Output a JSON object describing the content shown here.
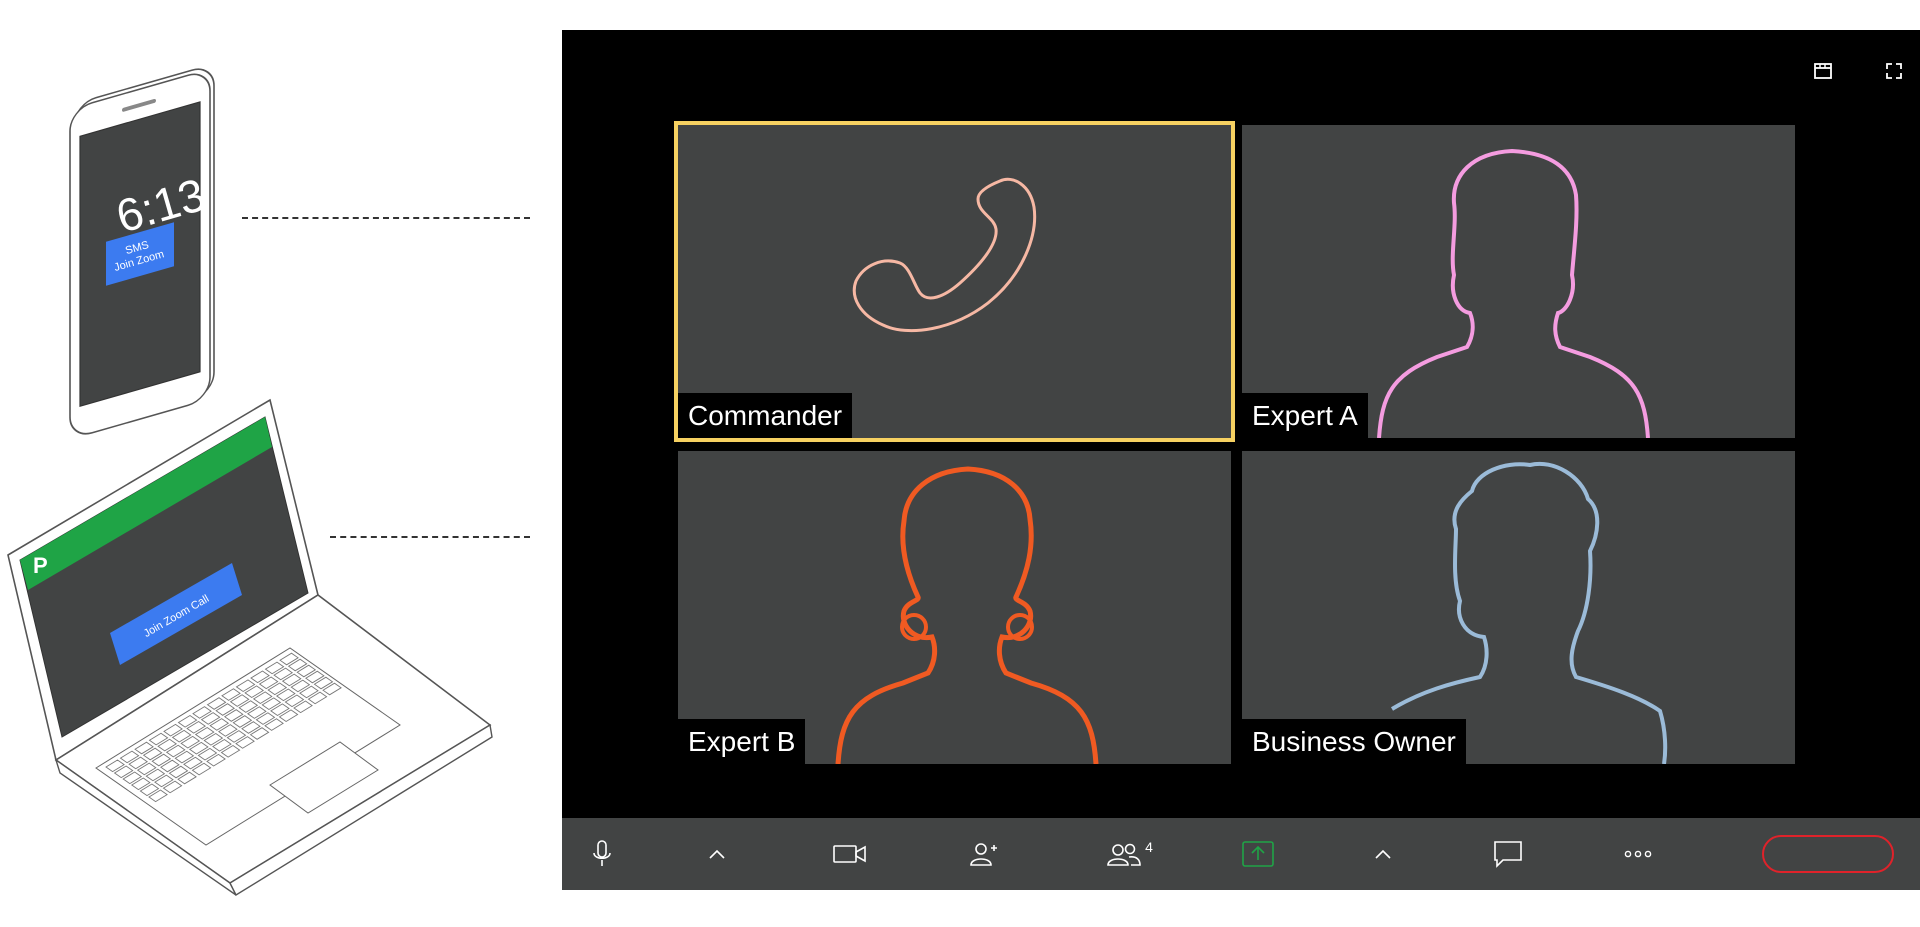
{
  "phone": {
    "time": "6:13",
    "sms_line1": "SMS",
    "sms_line2": "Join Zoom"
  },
  "laptop": {
    "logo": "P",
    "join_button": "Join Zoom Call"
  },
  "call": {
    "tiles": [
      {
        "name": "Commander",
        "active": true,
        "art": "phone-handset",
        "color": "#f6b8a4"
      },
      {
        "name": "Expert A",
        "art": "silhouette-man",
        "color": "#f49ce0"
      },
      {
        "name": "Expert B",
        "art": "silhouette-woman",
        "color": "#f05a22"
      },
      {
        "name": "Business Owner",
        "art": "silhouette-curly",
        "color": "#9bbbd8"
      }
    ],
    "participants_count": "4",
    "colors": {
      "active_border": "#f6d161",
      "share_green": "#1fa446",
      "end_red": "#e0222a",
      "laptop_bar": "#1fa446",
      "blue_button": "#3c7bf0"
    }
  }
}
